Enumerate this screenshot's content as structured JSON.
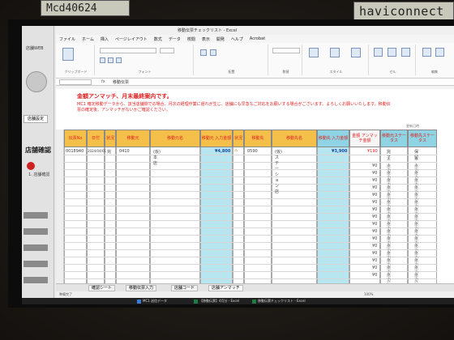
{
  "stickers": {
    "left": "Mcd40624",
    "right": "haviconnect"
  },
  "sidebar": {
    "title": "店舗WEB",
    "button_label": "店舗設定",
    "heading": "店舗確認",
    "sub": "1. 店舗確認"
  },
  "window": {
    "title": "移動伝票チェックリスト - Excel"
  },
  "menu": [
    "ファイル",
    "ホーム",
    "挿入",
    "ページレイアウト",
    "数式",
    "データ",
    "校閲",
    "表示",
    "開発",
    "ヘルプ",
    "Acrobat"
  ],
  "ribbon": {
    "groups": [
      "クリップボード",
      "フォント",
      "配置",
      "数値",
      "スタイル",
      "セル",
      "編集"
    ],
    "style_buttons": [
      "条件付き書式",
      "テーブルとして書式設定",
      "セルのスタイル"
    ],
    "cell_buttons": [
      "挿入",
      "削除",
      "書式"
    ]
  },
  "formula_bar": {
    "fx": "fx",
    "value": "移動伝票"
  },
  "sheet": {
    "notice_title": "金額アンマッチ、月末最終案内です。",
    "notice_body": "MC1 確定移動データから、該当店舗側での場合、月次の経理作業に遅れが生じ、店舗にも早急なご対応をお願いする場合がございます。よろしくお願いいたします。移動伝票の確定後、アンマッチがないかご確認ください。",
    "updated": "更新日時",
    "headers": [
      "伝票No",
      "日付",
      "状況",
      "移動元",
      "移動元名",
      "移動元 入力金額",
      "状況",
      "移動先",
      "移動先名",
      "移動先 入力金額",
      "金額 アンマッチ金額",
      "移動元ステータス",
      "移動先ステータス"
    ],
    "first_row": [
      "0018940",
      "2024/04/01",
      "完",
      "0410",
      "(仮)本店",
      "¥4,800",
      "⚠",
      "0590",
      "(仮)ステーション店",
      "¥3,900",
      "¥190",
      "完了",
      "保留"
    ],
    "yen_zero": "¥0",
    "status_a": "未入力",
    "status_b": "未入力"
  },
  "tabs": [
    "確認シート",
    "移動伝票入力",
    "店舗コード",
    "店舗アンマッチ"
  ],
  "status_bar": {
    "left": "準備完了",
    "right": "100%"
  },
  "taskbar": [
    "MC1 送信データ",
    "【移動伝票】4月分 - Excel",
    "移動伝票チェックリスト - Excel"
  ]
}
